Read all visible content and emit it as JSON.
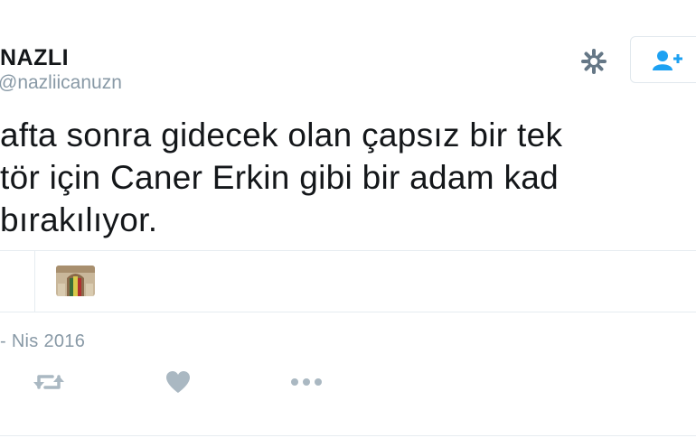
{
  "profile": {
    "display_name": "NAZLI",
    "screen_name": "@nazliicanuzn"
  },
  "header": {
    "settings_icon": "gear-icon",
    "follow_icon": "follow-user-icon"
  },
  "tweet": {
    "text_lines": [
      "afta sonra gidecek olan çapsız bir tek",
      "tör için Caner Erkin gibi bir adam kad",
      "bırakılıyor."
    ],
    "date": "- Nis 2016"
  },
  "actions": {
    "retweet_icon": "retweet-icon",
    "like_icon": "heart-icon",
    "more_icon": "more-dots-icon"
  },
  "colors": {
    "text": "#14171a",
    "muted": "#8899a6",
    "accent": "#1da1f2",
    "divider": "#e6ecf0"
  }
}
